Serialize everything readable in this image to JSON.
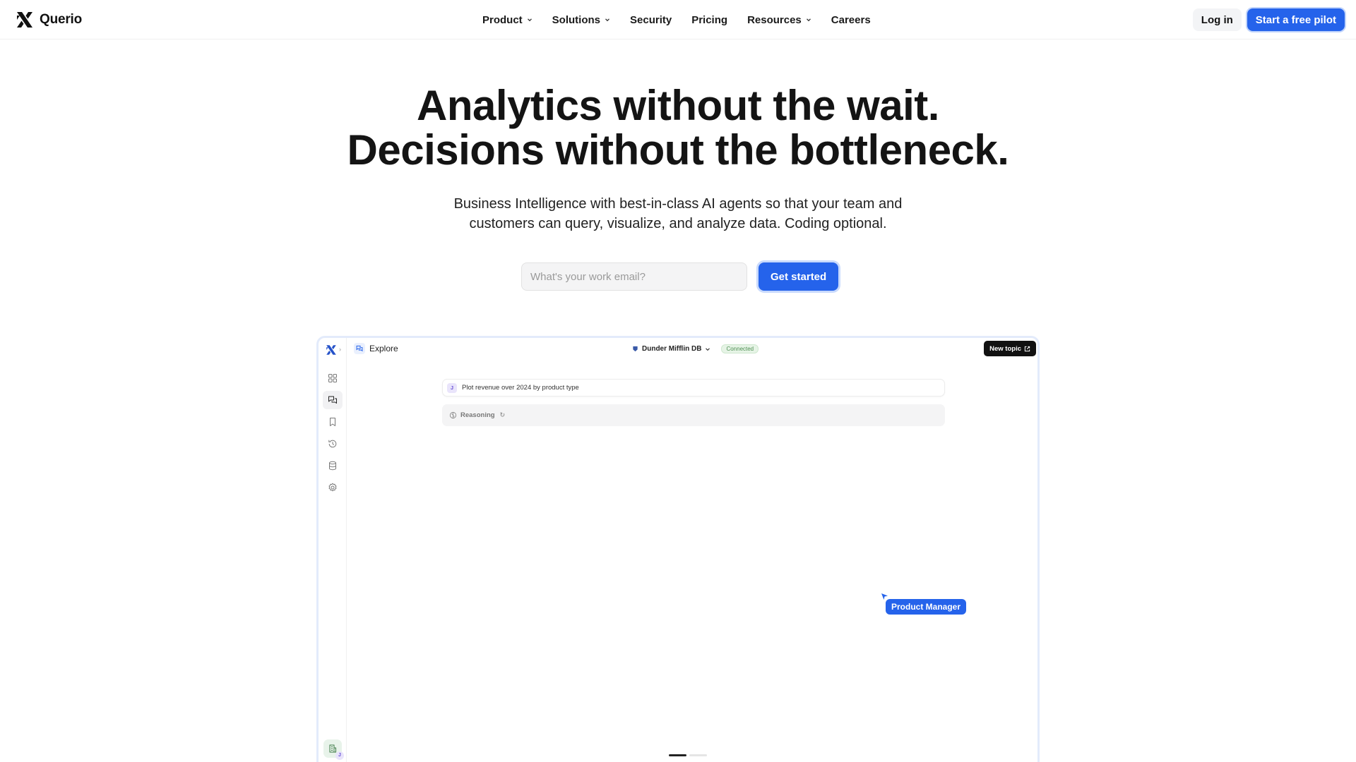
{
  "brand": {
    "name": "Querio"
  },
  "nav": {
    "items": [
      {
        "label": "Product",
        "has_dropdown": true
      },
      {
        "label": "Solutions",
        "has_dropdown": true
      },
      {
        "label": "Security",
        "has_dropdown": false
      },
      {
        "label": "Pricing",
        "has_dropdown": false
      },
      {
        "label": "Resources",
        "has_dropdown": true
      },
      {
        "label": "Careers",
        "has_dropdown": false
      }
    ],
    "login_label": "Log in",
    "pilot_label": "Start a free pilot"
  },
  "hero": {
    "title_line1": "Analytics without the wait.",
    "title_line2": "Decisions without the bottleneck.",
    "subtitle_line1": "Business Intelligence with best-in-class AI agents so that your team and",
    "subtitle_line2": "customers can query, visualize, and analyze data. Coding optional.",
    "email_placeholder": "What's your work email?",
    "cta_label": "Get started"
  },
  "app": {
    "section_title": "Explore",
    "database_name": "Dunder Mifflin DB",
    "connection_status": "Connected",
    "new_topic_label": "New topic",
    "prompt_avatar": "J",
    "prompt_text": "Plot revenue over 2024 by product type",
    "reasoning_label": "Reasoning",
    "user_avatar_badge": "J",
    "cursor_label": "Product Manager",
    "sidebar_icons": [
      "grid-icon",
      "chat-icon",
      "bookmark-icon",
      "history-icon",
      "database-icon",
      "settings-icon"
    ],
    "carousel_active_slide": 1,
    "carousel_slide_count": 2
  },
  "colors": {
    "accent": "#2563eb",
    "connected_bg": "#e6f4e6",
    "connected_text": "#4f8f53",
    "avatar_bg": "#e9e4fb"
  }
}
